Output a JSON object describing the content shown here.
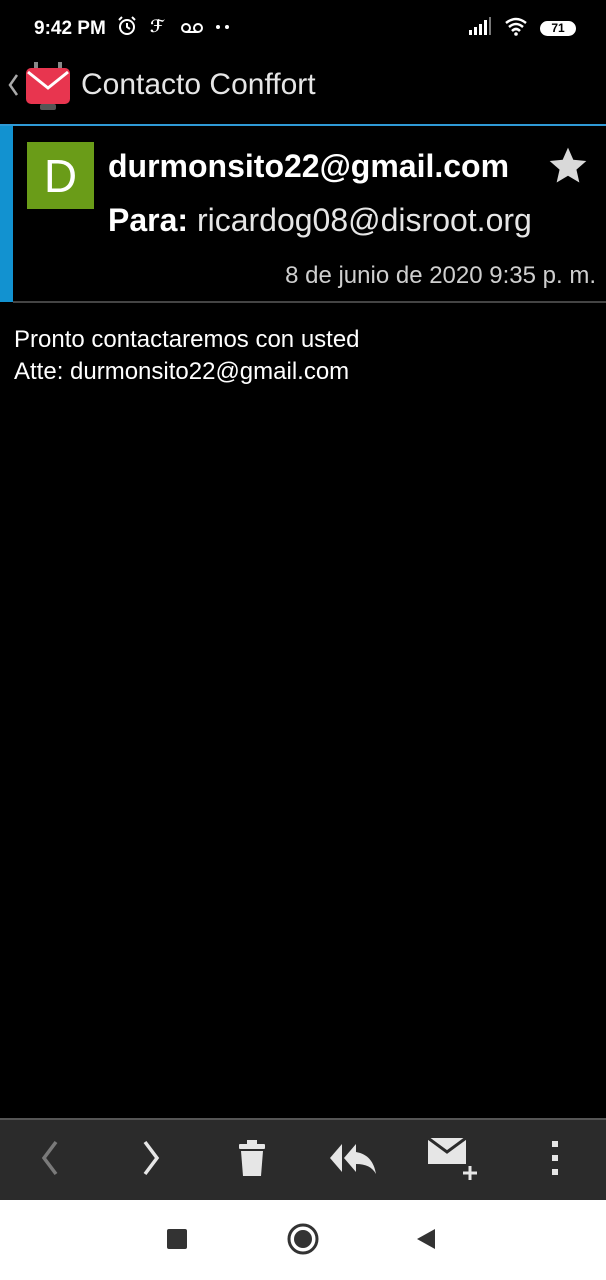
{
  "status_bar": {
    "time": "9:42 PM",
    "left_icons": [
      "alarm-icon",
      "lastfm-icon",
      "voicemail-icon",
      "more-dots-icon"
    ],
    "right_icons": [
      "signal-icon",
      "wifi-icon",
      "battery-icon"
    ],
    "battery": "71"
  },
  "app_bar": {
    "title": "Contacto Conffort",
    "back_icon": "chevron-left-icon",
    "logo_icon": "k9-mail-logo-icon"
  },
  "message": {
    "avatar_letter": "D",
    "avatar_color": "#6a9c18",
    "from": "durmonsito22@gmail.com",
    "to_label": "Para:",
    "to": "ricardog08@disroot.org",
    "date": "8 de junio de 2020 9:35 p. m.",
    "starred": false,
    "body_lines": [
      "Pronto contactaremos con usted",
      "Atte: durmonsito22@gmail.com"
    ]
  },
  "toolbar": {
    "items": [
      "previous-icon",
      "next-icon",
      "delete-icon",
      "reply-all-icon",
      "compose-icon",
      "overflow-menu-icon"
    ]
  },
  "nav_bar": {
    "items": [
      "recents-icon",
      "home-icon",
      "back-icon"
    ]
  },
  "colors": {
    "accent": "#1292d0",
    "toolbar_bg": "#2b2b2b"
  }
}
